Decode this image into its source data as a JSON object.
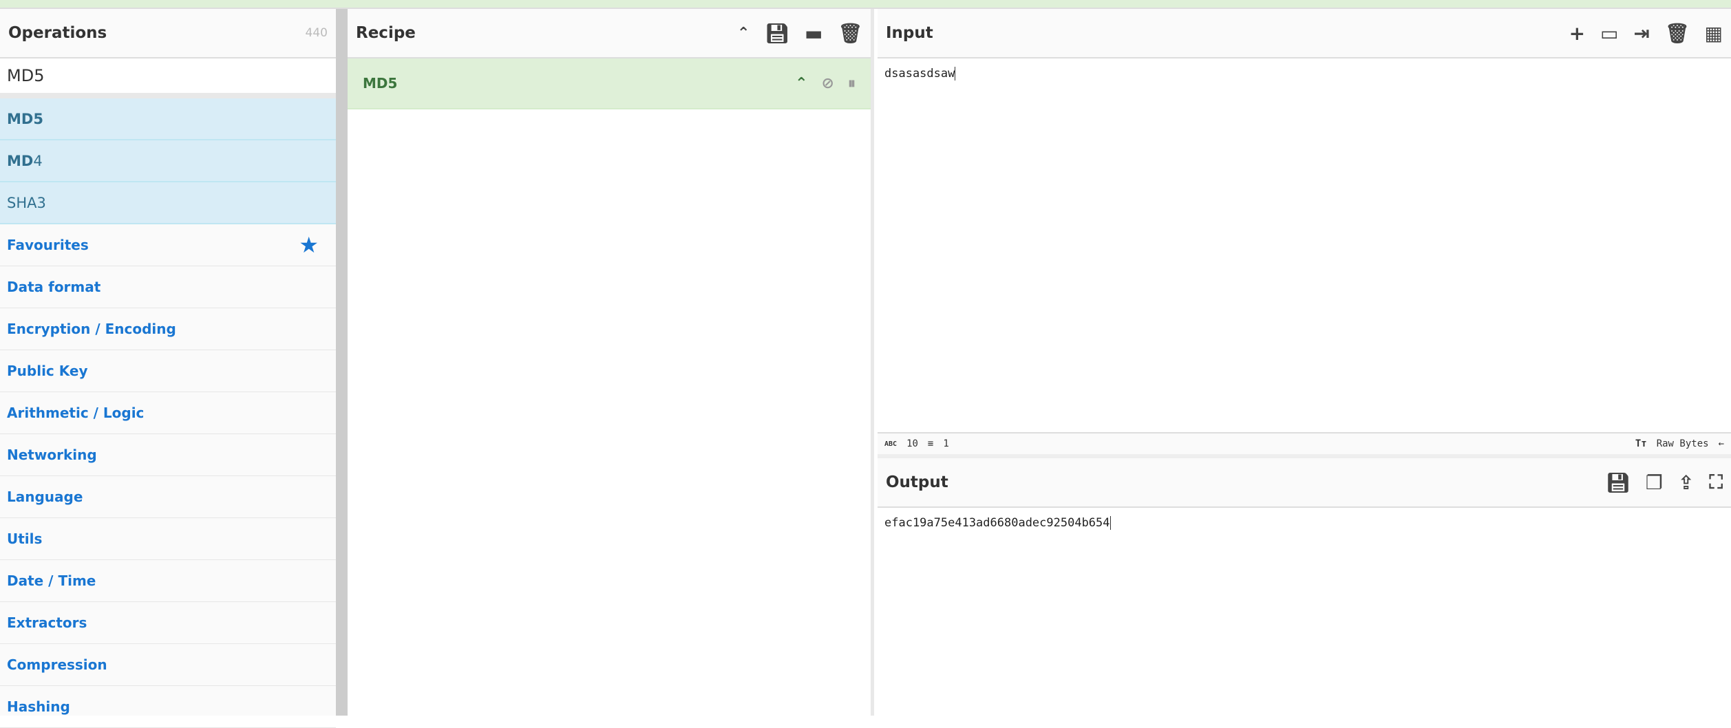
{
  "operations": {
    "title": "Operations",
    "count": "440",
    "search_value": "MD5",
    "results": [
      {
        "bold": "MD5",
        "rest": ""
      },
      {
        "bold": "MD",
        "rest": "4"
      },
      {
        "bold": "",
        "rest": "SHA3"
      }
    ],
    "categories": [
      "Favourites",
      "Data format",
      "Encryption / Encoding",
      "Public Key",
      "Arithmetic / Logic",
      "Networking",
      "Language",
      "Utils",
      "Date / Time",
      "Extractors",
      "Compression",
      "Hashing"
    ]
  },
  "recipe": {
    "title": "Recipe",
    "operation": "MD5"
  },
  "input": {
    "title": "Input",
    "value": "dsasasdsaw",
    "stats": {
      "length": "10",
      "lines": "1"
    },
    "encoding": "Raw Bytes"
  },
  "output": {
    "title": "Output",
    "value": "efac19a75e413ad6680adec92504b654"
  },
  "colors": {
    "accent": "#1976d2",
    "recipe_bg": "#dff0d8",
    "result_bg": "#d9edf7"
  }
}
